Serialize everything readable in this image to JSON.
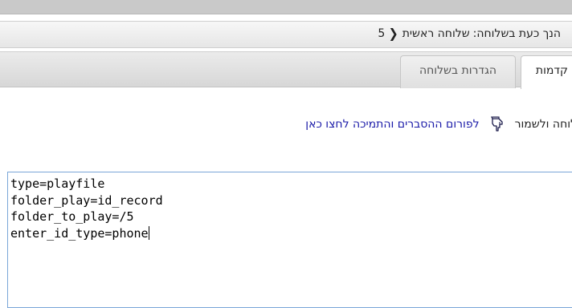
{
  "breadcrumb": {
    "prefix": "הנך כעת בשלוחה:",
    "current": "שלוחה ראשית",
    "separator_icon": "chevron-left-icon",
    "extension_number": "5"
  },
  "tabs": [
    {
      "label": "קדמות",
      "active": true
    },
    {
      "label": "הגדרות בשלוחה",
      "active": false
    }
  ],
  "content": {
    "save_text": "לוחה ולשמור",
    "hand_icon": "pointing-hand-icon",
    "forum_link": "לפורום ההסברים והתמיכה לחצו כאן"
  },
  "editor": {
    "lines": [
      "type=playfile",
      "folder_play=id_record",
      "folder_to_play=/5",
      "enter_id_type=phone"
    ]
  },
  "colors": {
    "link": "#1a1aa8",
    "editor_border": "#7aa6d8",
    "topbar": "#c9c9c9"
  }
}
